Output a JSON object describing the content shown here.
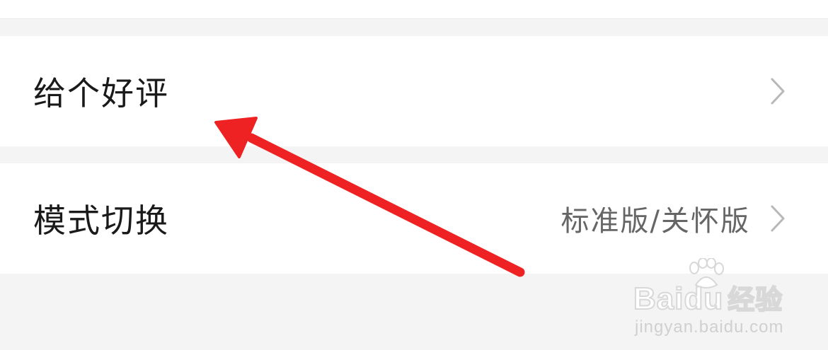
{
  "settings": {
    "items": [
      {
        "label": "给个好评",
        "value": ""
      },
      {
        "label": "模式切换",
        "value": "标准版/关怀版"
      }
    ]
  },
  "icons": {
    "chevron": "chevron-right-icon",
    "annotation": "red-arrow-annotation"
  },
  "colors": {
    "background": "#f4f4f4",
    "row": "#ffffff",
    "label": "#1a1a1a",
    "value": "#666666",
    "chevron": "#b8b8b8",
    "annotation_arrow": "#ee2222"
  },
  "watermark": {
    "brand_latin": "Bai",
    "brand_mid": "du",
    "brand_cn": "经验",
    "url": "jingyan.baidu.com"
  }
}
